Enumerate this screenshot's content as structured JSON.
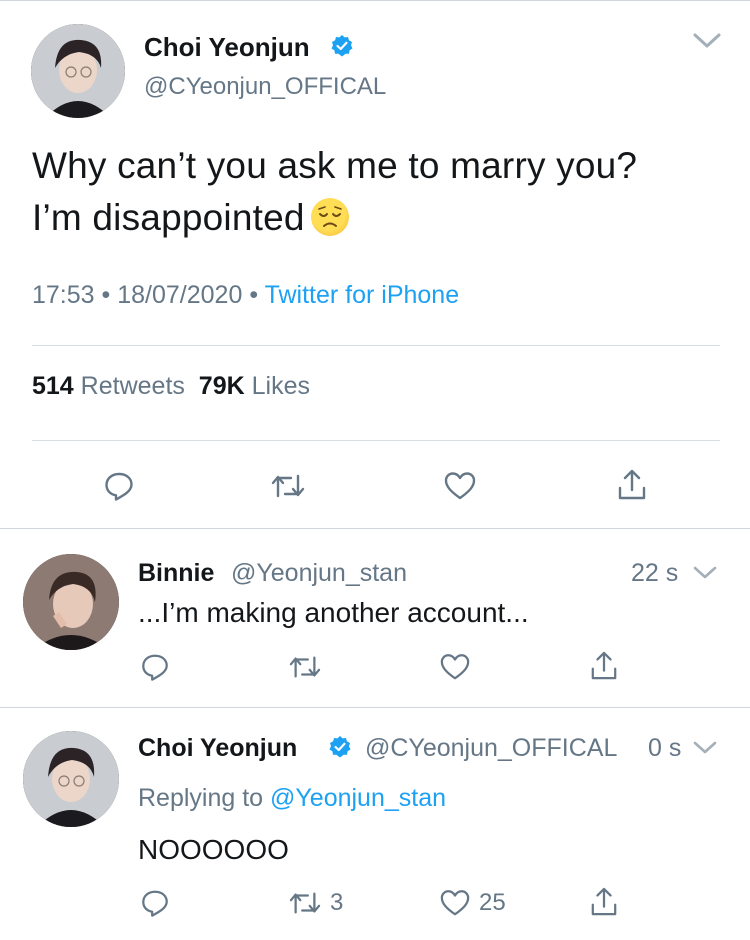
{
  "tweet": {
    "author_name": "Choi Yeonjun",
    "author_handle": "@CYeonjun_OFFICAL",
    "text_line1": "Why can’t you ask me to marry you?",
    "text_line2": "I’m disappointed",
    "emoji": "disappointed-face",
    "time": "17:53",
    "dot1": "•",
    "date": "18/07/2020",
    "dot2": "•",
    "source": "Twitter for iPhone",
    "retweets_count": "514",
    "retweets_label": "Retweets",
    "likes_count": "79K",
    "likes_label": "Likes"
  },
  "replies": [
    {
      "author_name": "Binnie",
      "author_handle": "@Yeonjun_stan",
      "time": "22 s",
      "text": "...I’m making another account...",
      "retweets": "",
      "likes": ""
    },
    {
      "author_name": "Choi Yeonjun",
      "author_handle": "@CYeonjun_OFFICAL",
      "time": "0 s",
      "replying_label": "Replying to",
      "replying_to": "@Yeonjun_stan",
      "text": "NOOOOOO",
      "retweets": "3",
      "likes": "25"
    }
  ],
  "colors": {
    "accent": "#1da1f2",
    "secondary_text": "#657786",
    "divider": "#d8dde1",
    "icon": "#657786"
  },
  "icons": [
    "verified-badge-icon",
    "chevron-down-icon",
    "reply-icon",
    "retweet-icon",
    "like-icon",
    "share-icon"
  ]
}
